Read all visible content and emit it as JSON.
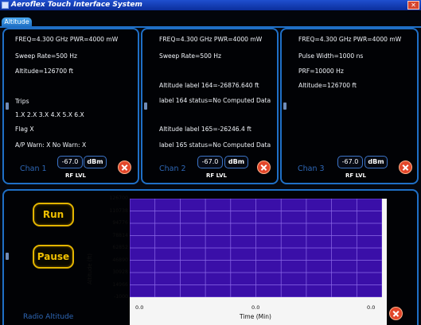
{
  "window": {
    "title": "Aeroflex Touch Interface System"
  },
  "tabs": [
    {
      "label": "Altitude"
    }
  ],
  "channels": [
    {
      "lines": [
        "FREQ=4.300 GHz   PWR=4000 mW",
        "Sweep Rate=500 Hz",
        "Altitude=126700 ft",
        "Trips",
        "1.X  2.X  3.X  4.X  5.X  6.X",
        "Flag  X",
        "A/P  Warn: X   No Warn: X"
      ],
      "name": "Chan 1",
      "value": "-67.0",
      "unit": "dBm",
      "rf_label": "RF LVL"
    },
    {
      "lines": [
        "FREQ=4.300 GHz   PWR=4000 mW",
        "Sweep Rate=500 Hz",
        "Altitude label 164=-26876.640 ft",
        "label 164 status=No Computed Data",
        "Altitude label 165=-26246.4 ft",
        "label 165 status=No Computed Data"
      ],
      "name": "Chan 2",
      "value": "-67.0",
      "unit": "dBm",
      "rf_label": "RF LVL"
    },
    {
      "lines": [
        "FREQ=4.300 GHz   PWR=4000 mW",
        "Pulse Width=1000 ns",
        "PRF=10000 Hz",
        "Altitude=126700 ft"
      ],
      "name": "Chan 3",
      "value": "-67.0",
      "unit": "dBm",
      "rf_label": "RF LVL"
    }
  ],
  "controls": {
    "run_label": "Run",
    "pause_label": "Pause",
    "section_label": "Radio Altitude"
  },
  "chart_data": {
    "type": "line",
    "series": [],
    "xlabel": "Time (Min)",
    "ylabel": "Altitude (ft)",
    "x_ticks": [
      "0.0",
      "0.0",
      "0.0"
    ],
    "y_ticks": [
      "126700",
      "110738",
      "94776",
      "78814",
      "62852",
      "46890",
      "30928",
      "14966",
      "-1000"
    ],
    "ylim": [
      -1000,
      126700
    ],
    "grid": true
  },
  "colors": {
    "accent": "#1f6fc6",
    "plot_bg": "#3a0fa8",
    "button_gold": "#e3b400",
    "close_red": "#e2462a"
  }
}
